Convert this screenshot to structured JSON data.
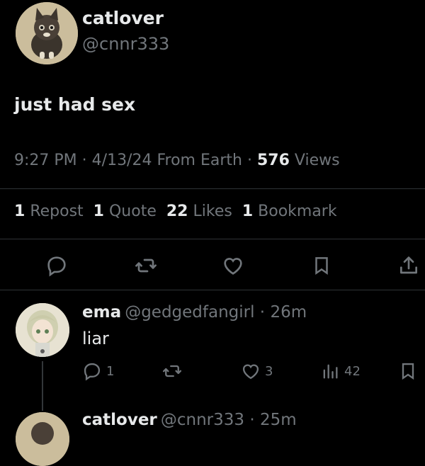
{
  "main_tweet": {
    "author_name": "catlover",
    "author_handle": "@cnnr333",
    "text": "just had sex",
    "time": "9:27 PM",
    "date": "4/13/24",
    "location": "From Earth",
    "views_count": "576",
    "views_label": "Views",
    "reposts_count": "1",
    "reposts_label": "Repost",
    "quotes_count": "1",
    "quotes_label": "Quote",
    "likes_count": "22",
    "likes_label": "Likes",
    "bookmarks_count": "1",
    "bookmarks_label": "Bookmark"
  },
  "action_bar": {
    "icons": [
      "reply-icon",
      "repost-icon",
      "like-icon",
      "bookmark-icon",
      "share-icon"
    ]
  },
  "reply": {
    "author_name": "ema",
    "author_handle": "@gedgedfangirl",
    "time": "26m",
    "text": "liar",
    "reply_count": "1",
    "repost_count": "",
    "like_count": "3",
    "views_count": "42"
  },
  "next_reply": {
    "author_name": "catlover",
    "author_handle": "@cnnr333",
    "time": "25m"
  },
  "colors": {
    "background": "#000000",
    "text": "#e7e9ea",
    "muted": "#71767b",
    "divider": "#2f3336"
  }
}
